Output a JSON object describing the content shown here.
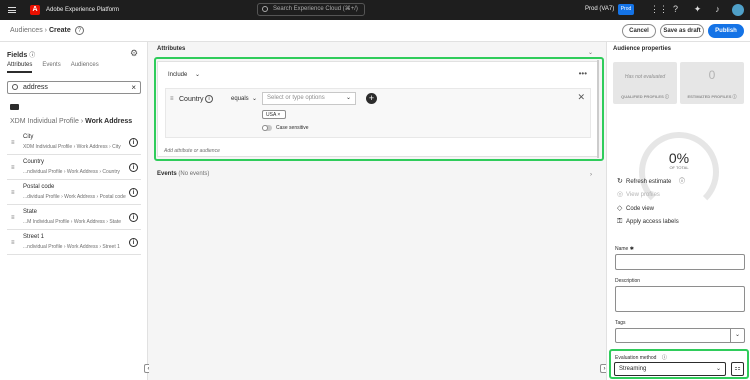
{
  "topbar": {
    "product": "Adobe Experience Platform",
    "search_placeholder": "Search Experience Cloud (⌘+/)",
    "sandbox": "Prod (VA7)",
    "env_badge": "Prod"
  },
  "header": {
    "breadcrumb_parent": "Audiences",
    "breadcrumb_sep": "›",
    "breadcrumb_current": "Create",
    "cancel_label": "Cancel",
    "save_draft_label": "Save as draft",
    "publish_label": "Publish"
  },
  "left": {
    "title": "Fields",
    "tabs": [
      "Attributes",
      "Events",
      "Audiences"
    ],
    "search_value": "address",
    "path_root": "XDM Individual Profile",
    "path_sep": "›",
    "path_current": "Work Address",
    "items": [
      {
        "name": "City",
        "path": "XDM Individual Profile › Work Address › City"
      },
      {
        "name": "Country",
        "path": "...ndividual Profile › Work Address › Country"
      },
      {
        "name": "Postal code",
        "path": "...dividual Profile › Work Address › Postal code"
      },
      {
        "name": "State",
        "path": "...M Individual Profile › Work Address › State"
      },
      {
        "name": "Street 1",
        "path": "...ndividual Profile › Work Address › Street 1"
      }
    ]
  },
  "center": {
    "attributes_title": "Attributes",
    "include_label": "Include",
    "condition": {
      "attribute": "Country",
      "operator": "equals",
      "value_placeholder": "Select or type options",
      "chip": "USA",
      "case_label": "Case sensitive"
    },
    "add_placeholder": "Add attribute or audience",
    "events_title": "Events",
    "events_count": "(No events)"
  },
  "right": {
    "title": "Audience properties",
    "qualified_status": "Has not evaluated",
    "qualified_label": "QUALIFIED PROFILES",
    "estimated_value": "0",
    "estimated_label": "ESTIMATED PROFILES",
    "total_pct": "0%",
    "total_label": "OF TOTAL",
    "actions": {
      "refresh": "Refresh estimate",
      "view_profiles": "View profiles",
      "code_view": "Code view",
      "access_labels": "Apply access labels"
    },
    "name_label": "Name ✱",
    "description_label": "Description",
    "tags_label": "Tags",
    "eval_label": "Evaluation method",
    "eval_value": "Streaming"
  }
}
